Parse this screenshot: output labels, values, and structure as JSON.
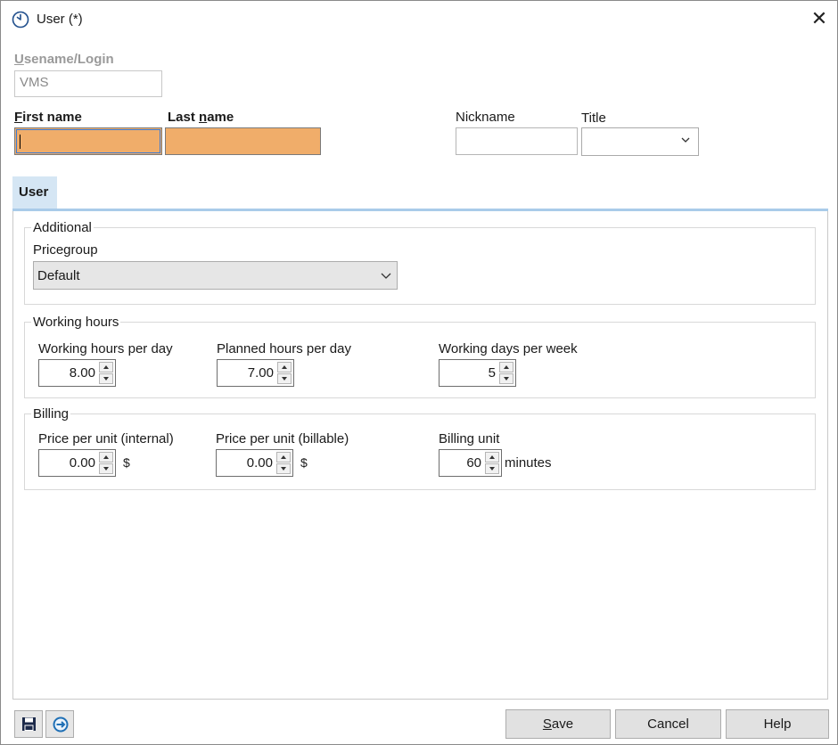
{
  "window": {
    "title": "User (*)"
  },
  "header": {
    "username_label": "Usename/Login",
    "username_value": "VMS",
    "first_name_label": "First name",
    "first_name_value": "",
    "last_name_label": "Last name",
    "last_name_value": "",
    "nickname_label": "Nickname",
    "nickname_value": "",
    "title_label": "Title",
    "title_value": ""
  },
  "tabs": [
    {
      "label": "User",
      "active": true
    }
  ],
  "additional": {
    "title": "Additional",
    "pricegroup_label": "Pricegroup",
    "pricegroup_value": "Default"
  },
  "working_hours": {
    "title": "Working hours",
    "per_day_label": "Working hours per day",
    "per_day_value": "8.00",
    "planned_label": "Planned hours per day",
    "planned_value": "7.00",
    "days_label": "Working days per week",
    "days_value": "5"
  },
  "billing": {
    "title": "Billing",
    "internal_label": "Price per unit (internal)",
    "internal_value": "0.00",
    "internal_unit": "$",
    "billable_label": "Price per unit (billable)",
    "billable_value": "0.00",
    "billable_unit": "$",
    "unit_label": "Billing unit",
    "unit_value": "60",
    "unit_suffix": "minutes"
  },
  "footer": {
    "save": "Save",
    "cancel": "Cancel",
    "help": "Help"
  },
  "colors": {
    "required_field": "#f0ad6a",
    "tab_active": "#d5e6f4",
    "tab_line": "#a9cbe9",
    "accent_blue": "#1f6fb5"
  },
  "icons": {
    "app": "clock-icon",
    "close": "close-icon",
    "save": "floppy-disk-icon",
    "refresh": "refresh-arrow-icon"
  }
}
